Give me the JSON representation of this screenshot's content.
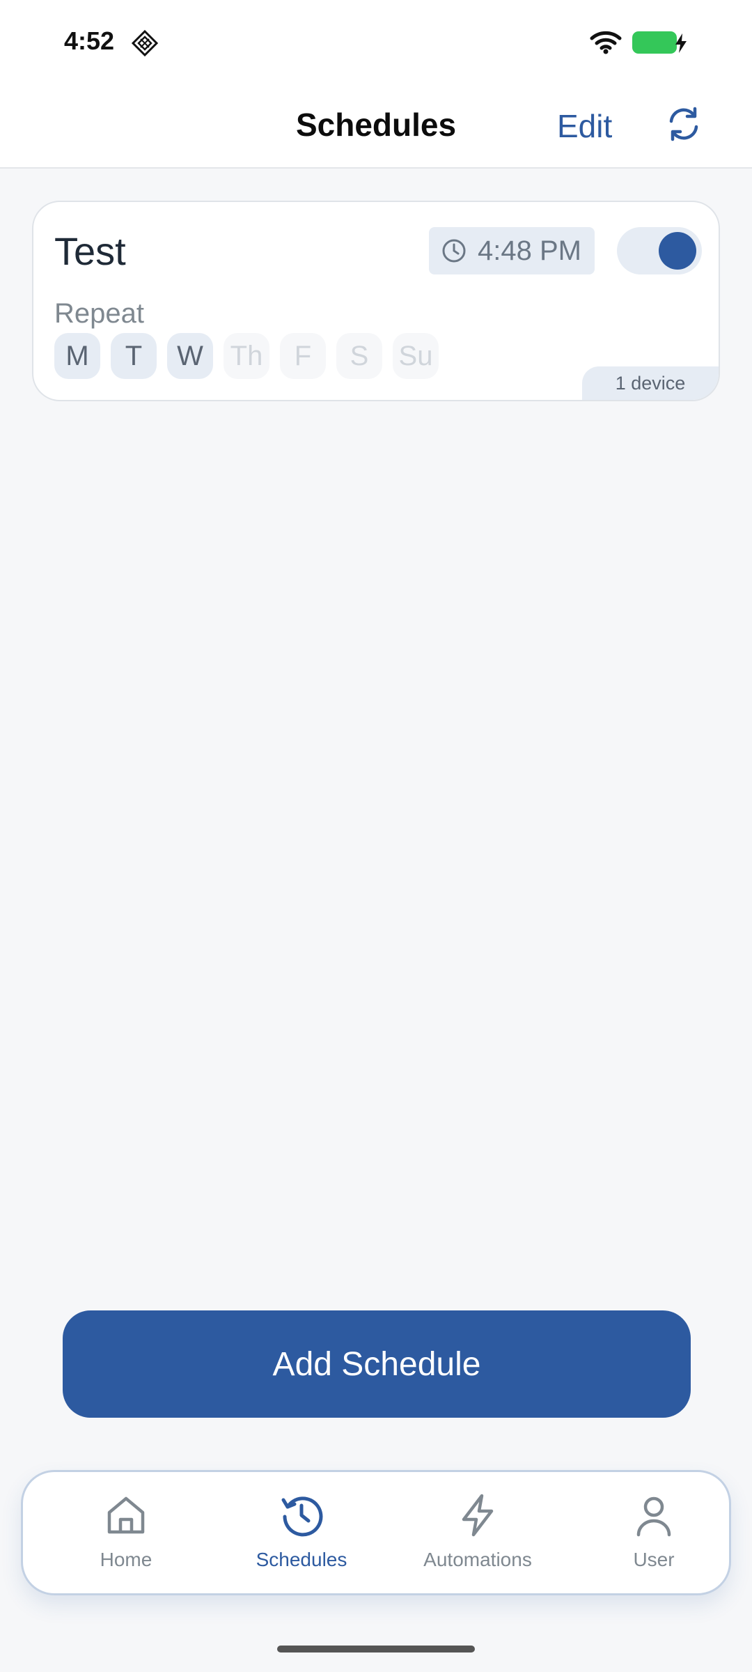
{
  "status_bar": {
    "time": "4:52"
  },
  "header": {
    "title": "Schedules",
    "edit_label": "Edit"
  },
  "schedule": {
    "name": "Test",
    "time": "4:48 PM",
    "enabled": true,
    "repeat_label": "Repeat",
    "days": [
      {
        "label": "M",
        "active": true
      },
      {
        "label": "T",
        "active": true
      },
      {
        "label": "W",
        "active": true
      },
      {
        "label": "Th",
        "active": false
      },
      {
        "label": "F",
        "active": false
      },
      {
        "label": "S",
        "active": false
      },
      {
        "label": "Su",
        "active": false
      }
    ],
    "device_count": "1 device"
  },
  "add_button_label": "Add Schedule",
  "tabs": [
    {
      "label": "Home",
      "icon": "home-icon",
      "active": false
    },
    {
      "label": "Schedules",
      "icon": "history-icon",
      "active": true
    },
    {
      "label": "Automations",
      "icon": "bolt-icon",
      "active": false
    },
    {
      "label": "User",
      "icon": "user-icon",
      "active": false
    }
  ],
  "colors": {
    "accent": "#2d5aa0",
    "chip_bg": "#e6ecf4",
    "inactive_text": "#7f8890",
    "battery": "#34c759"
  }
}
